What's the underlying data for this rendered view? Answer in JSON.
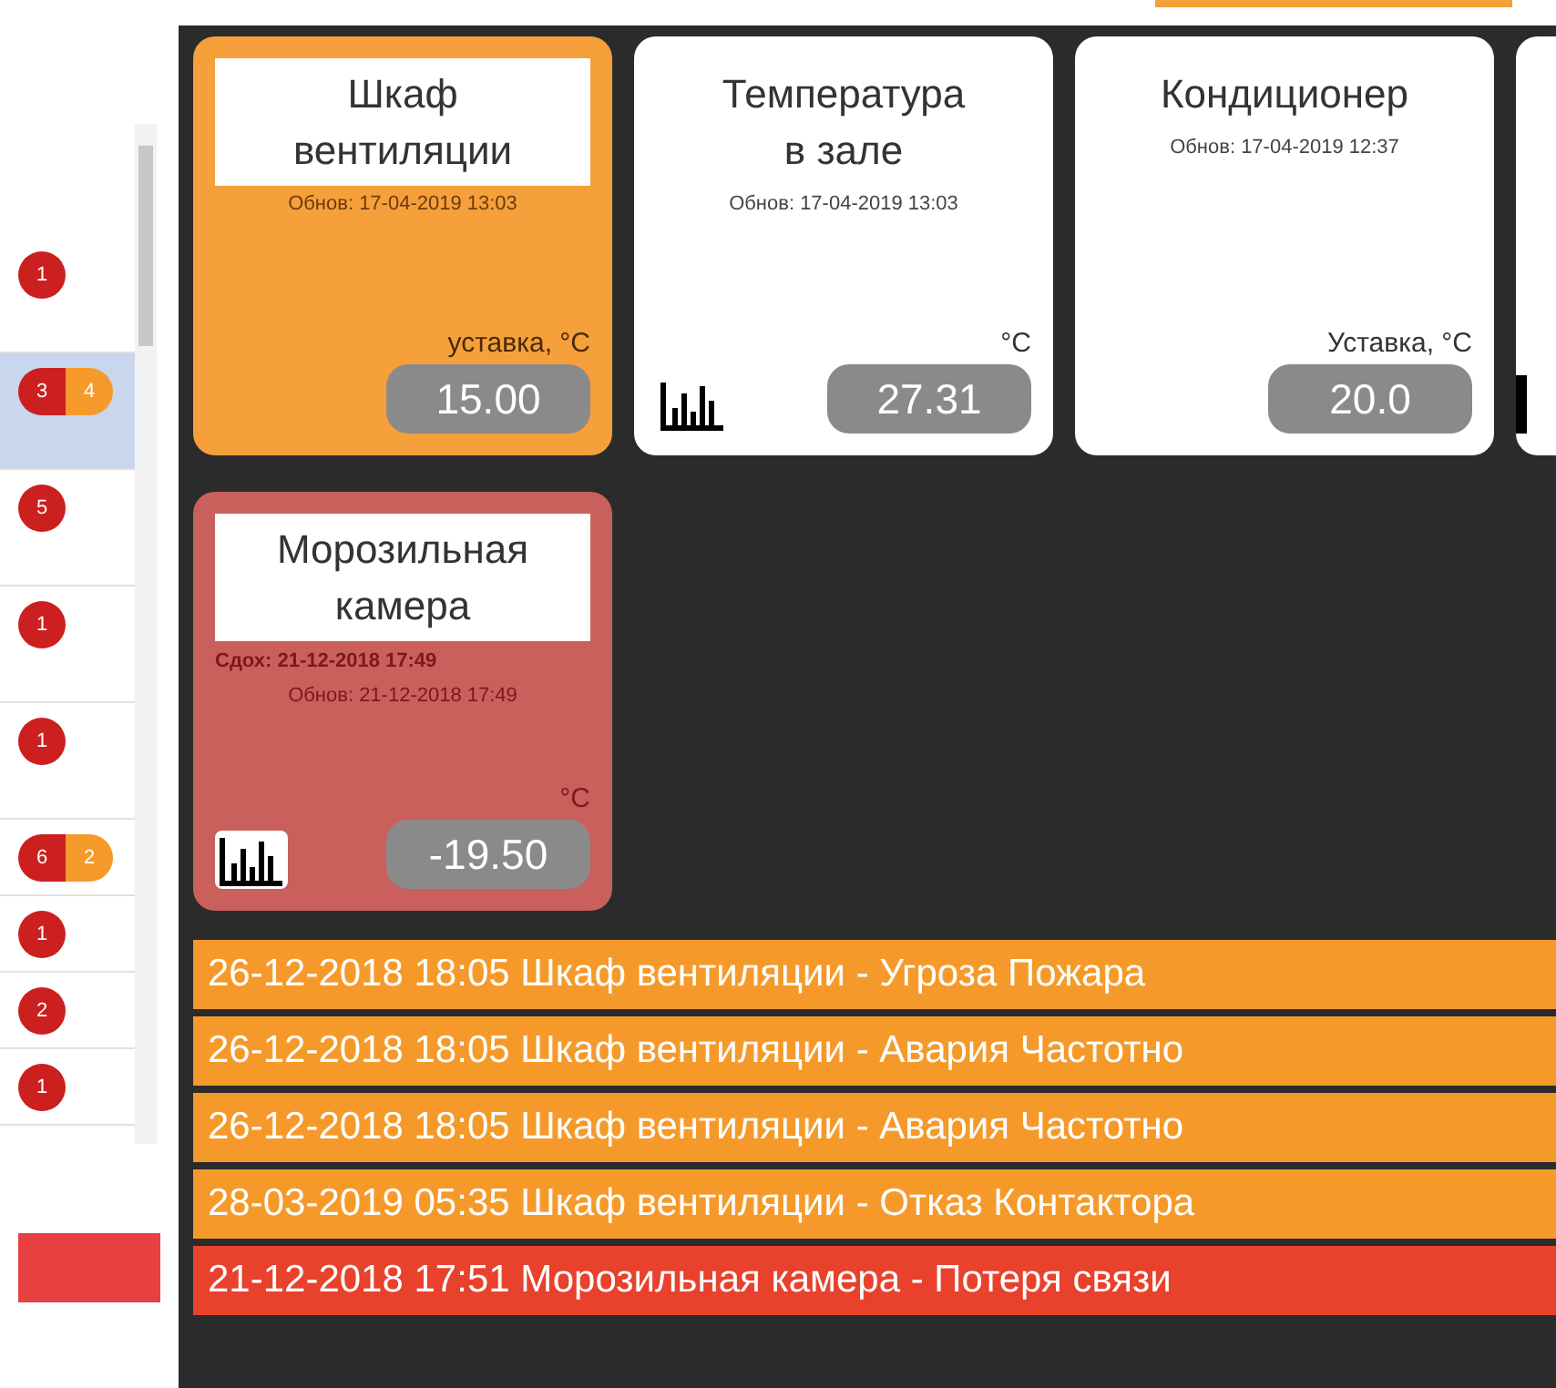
{
  "sidebar": {
    "items": [
      {
        "selected": false,
        "badges": [
          {
            "text": "1",
            "color": "#cc1f1f"
          }
        ]
      },
      {
        "selected": true,
        "badges": [
          {
            "text": "3",
            "color": "#cc1f1f"
          },
          {
            "text": "4",
            "color": "#f59a2a"
          }
        ]
      },
      {
        "selected": false,
        "badges": [
          {
            "text": "5",
            "color": "#cc1f1f"
          }
        ]
      },
      {
        "selected": false,
        "badges": [
          {
            "text": "1",
            "color": "#cc1f1f"
          }
        ]
      },
      {
        "selected": false,
        "badges": [
          {
            "text": "1",
            "color": "#cc1f1f"
          }
        ]
      },
      {
        "selected": false,
        "badges": [
          {
            "text": "6",
            "color": "#cc1f1f"
          },
          {
            "text": "2",
            "color": "#f59a2a"
          }
        ]
      },
      {
        "selected": false,
        "badges": [
          {
            "text": "1",
            "color": "#cc1f1f"
          }
        ]
      },
      {
        "selected": false,
        "badges": [
          {
            "text": "2",
            "color": "#cc1f1f"
          }
        ]
      },
      {
        "selected": false,
        "badges": [
          {
            "text": "1",
            "color": "#cc1f1f"
          }
        ]
      }
    ]
  },
  "cards": [
    {
      "kind": "warning",
      "title": "Шкаф вентиляции",
      "updated": "Обнов: 17-04-2019 13:03",
      "unit": "уставка, °C",
      "chart": false,
      "value": "15.00"
    },
    {
      "kind": "normal",
      "title": "Температура в зале",
      "updated": "Обнов: 17-04-2019 13:03",
      "unit": "°C",
      "chart": true,
      "value": "27.31"
    },
    {
      "kind": "normal",
      "title": "Кондиционер",
      "updated": "Обнов: 17-04-2019 12:37",
      "unit": "Уставка, °C",
      "chart": false,
      "value": "20.0"
    },
    {
      "kind": "offline",
      "title": "Морозильная камера",
      "dead": "Сдох: 21-12-2018 17:49",
      "updated": "Обнов: 21-12-2018 17:49",
      "unit": "°C",
      "chart": true,
      "value": "-19.50"
    }
  ],
  "alarms": [
    {
      "text": "26-12-2018 18:05 Шкаф вентиляции - Угроза Пожара",
      "color": "#f59a2a"
    },
    {
      "text": "26-12-2018 18:05 Шкаф вентиляции - Авария Частотно",
      "color": "#f59a2a"
    },
    {
      "text": "26-12-2018 18:05 Шкаф вентиляции - Авария Частотно",
      "color": "#f59a2a"
    },
    {
      "text": "28-03-2019 05:35 Шкаф вентиляции - Отказ Контактора",
      "color": "#f59a2a"
    },
    {
      "text": "21-12-2018 17:51 Морозильная камера - Потеря связи",
      "color": "#e8412c"
    }
  ]
}
